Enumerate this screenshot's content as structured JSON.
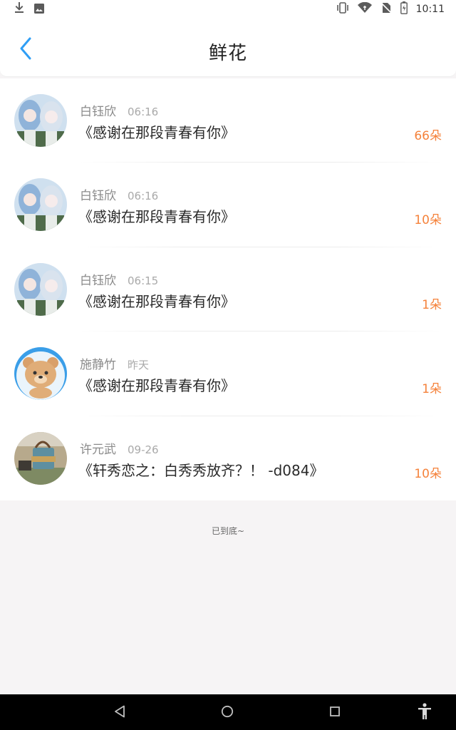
{
  "status_bar": {
    "time": "10:11",
    "left_icons": [
      "download-icon",
      "image-icon"
    ],
    "right_icons": [
      "vibrate-icon",
      "wifi-icon",
      "no-sim-icon",
      "battery-icon"
    ]
  },
  "header": {
    "title": "鲜花",
    "back_icon": "chevron-left-icon"
  },
  "gifts": [
    {
      "sender": "白钰欣",
      "time": "06:16",
      "message": "《感谢在那段青春有你》",
      "count": "66朵",
      "avatar": "anime-avatar"
    },
    {
      "sender": "白钰欣",
      "time": "06:16",
      "message": "《感谢在那段青春有你》",
      "count": "10朵",
      "avatar": "anime-avatar"
    },
    {
      "sender": "白钰欣",
      "time": "06:15",
      "message": "《感谢在那段青春有你》",
      "count": "1朵",
      "avatar": "anime-avatar"
    },
    {
      "sender": "施静竹",
      "time": "昨天",
      "message": "《感谢在那段青春有你》",
      "count": "1朵",
      "avatar": "bear-avatar"
    },
    {
      "sender": "许元武",
      "time": "09-26",
      "message": "《轩秀恋之：白秀秀放齐？！ -d084》",
      "count": "10朵",
      "avatar": "photo-avatar"
    }
  ],
  "footer": {
    "end_text": "已到底~"
  },
  "colors": {
    "accent": "#2f9ef5",
    "count": "#f5823b",
    "background": "#f6f4f5"
  },
  "nav_bar": {
    "icons": [
      "back-triangle-icon",
      "home-circle-icon",
      "recents-square-icon",
      "accessibility-icon"
    ]
  }
}
